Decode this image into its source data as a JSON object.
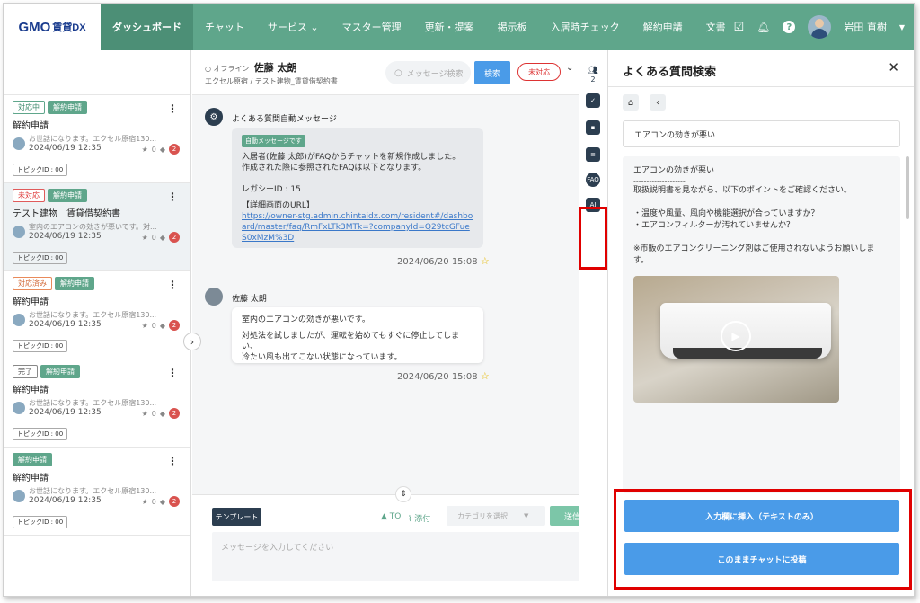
{
  "logo": {
    "brand": "GMO",
    "product": "賃貸DX"
  },
  "nav": [
    "ダッシュボード",
    "チャット",
    "サービス ⌄",
    "マスター管理",
    "更新・提案",
    "掲示板",
    "入居時チェック",
    "解約申請",
    "文書"
  ],
  "user": {
    "name": "岩田 直樹"
  },
  "cards": [
    {
      "status": "対応中",
      "status_kind": "green",
      "type": "解約申請",
      "title": "解約申請",
      "preview": "お世話になります。エクセル原宿130...",
      "date": "2024/06/19 12:35",
      "stars": "0",
      "count": "2",
      "topic": "トピックID : 00"
    },
    {
      "status": "未対応",
      "status_kind": "red",
      "type": "解約申請",
      "title": "テスト建物＿賃貸借契約書",
      "preview": "室内のエアコンの効きが悪いです。対...",
      "date": "2024/06/19 12:35",
      "stars": "0",
      "count": "2",
      "topic": "トピックID : 00"
    },
    {
      "status": "対応済み",
      "status_kind": "orange",
      "type": "解約申請",
      "title": "解約申請",
      "preview": "お世話になります。エクセル原宿130...",
      "date": "2024/06/19 12:35",
      "stars": "0",
      "count": "2",
      "topic": "トピックID : 00"
    },
    {
      "status": "完了",
      "status_kind": "gray",
      "type": "解約申請",
      "title": "解約申請",
      "preview": "お世話になります。エクセル原宿130...",
      "date": "2024/06/19 12:35",
      "stars": "0",
      "count": "2",
      "topic": "トピックID : 00"
    },
    {
      "status": "",
      "status_kind": "none",
      "type": "解約申請",
      "title": "解約申請",
      "preview": "お世話になります。エクセル原宿130...",
      "date": "2024/06/19 12:35",
      "stars": "0",
      "count": "2",
      "topic": "トピックID : 00"
    }
  ],
  "chat": {
    "offline": "○ オフライン",
    "name": "佐藤 太朗",
    "subtitle": "エクセル原宿 / テスト建物_賃貸借契約書",
    "search_placeholder": "メッセージ検索",
    "search_button": "検索",
    "status": "未対応",
    "bot_sender": "よくある質問自動メッセージ",
    "auto_tag": "自動メッセージです",
    "bot_line1": "入居者(佐藤 太郎)がFAQからチャットを新規作成しました。",
    "bot_line2": "作成された際に参照されたFAQは以下となります。",
    "legacy": "レガシーID : 15",
    "detail_label": "【詳細画面のURL】",
    "detail_url": "https://owner-stg.admin.chintaidx.com/resident#/dashboard/master/faq/RmFxLTk3MTk=?companyId=Q29tcGFueS0xMzM%3D",
    "bot_time": "2024/06/20 15:08",
    "user_sender": "佐藤 太朗",
    "user_line1": "室内のエアコンの効きが悪いです。",
    "user_line2": "対処法を試しましたが、運転を始めてもすぐに停止してしまい、",
    "user_line3": "冷たい風も出てこない状態になっています。",
    "user_time": "2024/06/20 15:08"
  },
  "tools": {
    "members_count": "2",
    "faq": "FAQ",
    "ai": "AI"
  },
  "composer": {
    "template": "テンプレート",
    "to": "TO",
    "attach": "添付",
    "category_placeholder": "カテゴリを選択",
    "send": "送信",
    "placeholder": "メッセージを入力してください"
  },
  "faq": {
    "title": "よくある質問検索",
    "question": "エアコンの効きが悪い",
    "answer_title": "エアコンの効きが悪い",
    "answer_rule": "--------------------",
    "answer_1": "取扱説明書を見ながら、以下のポイントをご確認ください。",
    "answer_2": "・温度や風量、風向や機能選択が合っていますか？",
    "answer_3": "・エアコンフィルターが汚れていませんか？",
    "answer_4": "※市販のエアコンクリーニング剤はご使用されないようお願いします。",
    "insert_button": "入力欄に挿入（テキストのみ）",
    "post_button": "このままチャットに投稿"
  }
}
